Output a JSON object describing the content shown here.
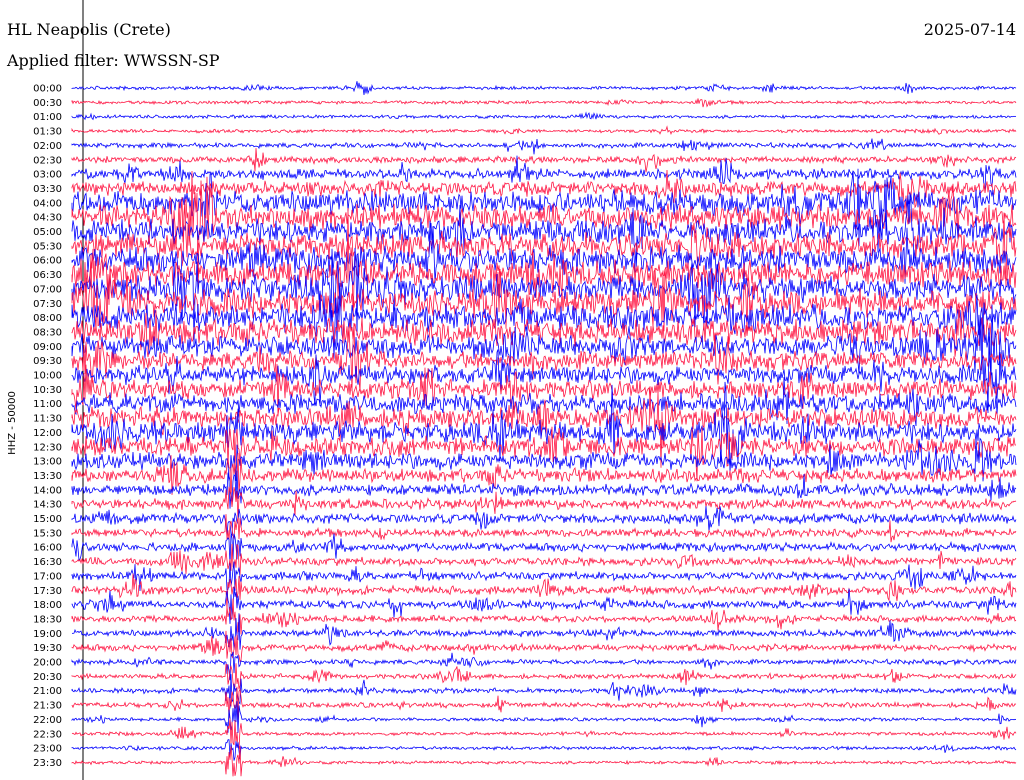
{
  "header": {
    "station": "HL Neapolis (Crete)",
    "filter": "Applied filter: WWSSN-SP",
    "date": "2025-07-14"
  },
  "chart_data": {
    "type": "line",
    "title": "HL Neapolis (Crete)",
    "subtitle": "Applied filter: WWSSN-SP",
    "date": "2025-07-14",
    "ylabel": "HHZ - 50000",
    "series_colors": [
      "#0000ff",
      "#ff1744"
    ],
    "grid": false,
    "y_ticks": [
      "00:00",
      "00:30",
      "01:00",
      "01:30",
      "02:00",
      "02:30",
      "03:00",
      "03:30",
      "04:00",
      "04:30",
      "05:00",
      "05:30",
      "06:00",
      "06:30",
      "07:00",
      "07:30",
      "08:00",
      "08:30",
      "09:00",
      "09:30",
      "10:00",
      "10:30",
      "11:00",
      "11:30",
      "12:00",
      "12:30",
      "13:00",
      "13:30",
      "14:00",
      "14:30",
      "15:00",
      "15:30",
      "16:00",
      "16:30",
      "17:00",
      "17:30",
      "18:00",
      "18:30",
      "19:00",
      "19:30",
      "20:00",
      "20:30",
      "21:00",
      "21:30",
      "22:00",
      "22:30",
      "23:00",
      "23:30"
    ],
    "trace_amplitude": [
      2,
      2,
      2,
      2,
      3,
      4,
      6,
      9,
      14,
      15,
      15,
      15,
      16,
      16,
      16,
      16,
      16,
      15,
      13,
      11,
      11,
      11,
      12,
      12,
      13,
      12,
      10,
      8,
      7,
      6,
      6,
      5,
      5,
      5,
      5,
      5,
      5,
      4,
      4,
      4,
      3,
      3,
      3,
      3,
      2,
      2,
      2,
      2
    ]
  }
}
